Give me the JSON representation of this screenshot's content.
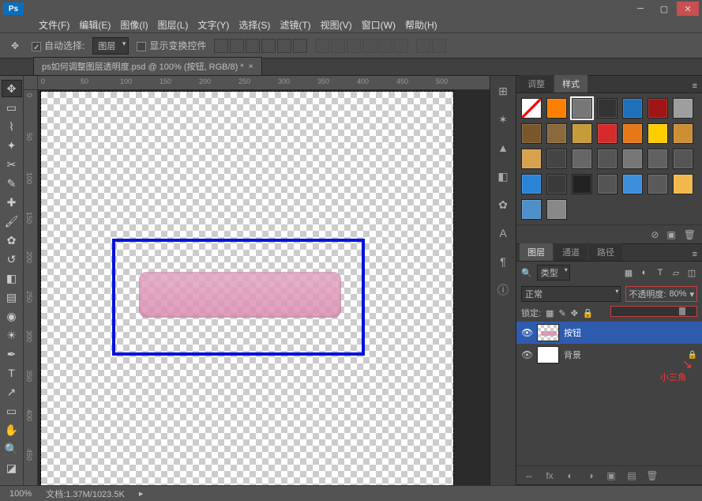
{
  "titlebar": {
    "app": "Ps"
  },
  "menu": {
    "items": [
      "文件(F)",
      "编辑(E)",
      "图像(I)",
      "图层(L)",
      "文字(Y)",
      "选择(S)",
      "滤镜(T)",
      "视图(V)",
      "窗口(W)",
      "帮助(H)"
    ]
  },
  "options": {
    "auto_select_label": "自动选择:",
    "target": "图层",
    "show_transform_label": "显示变换控件"
  },
  "document": {
    "tab_label": "ps如何调整图层透明度.psd @ 100% (按钮, RGB/8) *",
    "close_x": "×",
    "ruler_h": [
      "0",
      "50",
      "100",
      "150",
      "200",
      "250",
      "300",
      "350",
      "400",
      "450",
      "500"
    ],
    "ruler_v": [
      "0",
      "50",
      "100",
      "150",
      "200",
      "250",
      "300",
      "350",
      "400",
      "450"
    ]
  },
  "panels": {
    "adjustments_tab": "调整",
    "styles_tab": "样式",
    "swatch_colors": [
      "#ffffff",
      "#ff7f00",
      "#777777",
      "#333333",
      "#1e70b8",
      "#a01515",
      "#9e9e9e",
      "#7a572a",
      "#8a6a3d",
      "#c79a3a",
      "#d52b2b",
      "#e67817",
      "#ffcc00",
      "#cc8f33",
      "#d6a24d",
      "#444444",
      "#666666",
      "#555555",
      "#777777",
      "#606060",
      "#555555",
      "#2a84d6",
      "#3a3a3a",
      "#222222",
      "#555555",
      "#3d8edb",
      "#5a5a5a",
      "#f2b84b",
      "#4d8fc8",
      "#888888"
    ],
    "layers_tab": "图层",
    "channels_tab": "通道",
    "paths_tab": "路径",
    "kind_label": "类型",
    "blend_mode": "正常",
    "opacity_label": "不透明度:",
    "opacity_value": "80%",
    "lock_label": "锁定:",
    "annotation": "小三角",
    "layer1": "按钮",
    "layer2": "背景"
  },
  "status": {
    "zoom": "100%",
    "doc_info": "文档:1.37M/1023.5K"
  }
}
